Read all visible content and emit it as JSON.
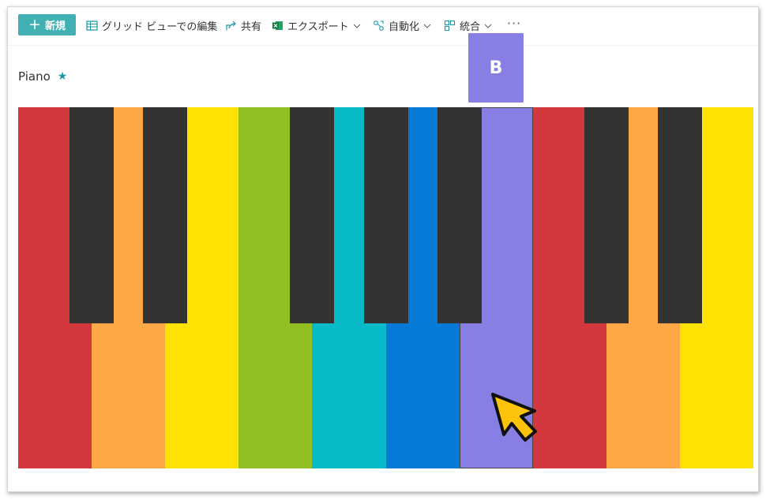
{
  "toolbar": {
    "new_label": "新規",
    "grid_edit_label": "グリッド ビューでの編集",
    "share_label": "共有",
    "export_label": "エクスポート",
    "automate_label": "自動化",
    "integrate_label": "統合",
    "more_label": "···"
  },
  "page": {
    "title": "Piano",
    "favorite_icon": "star-icon"
  },
  "piano": {
    "white_keys": [
      "#d2383e",
      "#fea746",
      "#fee204",
      "#92bf22",
      "#07bac7",
      "#0779d7",
      "#877fe3",
      "#d2383e",
      "#fea746",
      "#fee204"
    ],
    "black_keys": [
      0,
      1,
      3,
      4,
      5,
      7,
      8
    ],
    "pressed_key_index": 6,
    "pressed_key_label": "B"
  },
  "colors": {
    "accent": "#41b0b2",
    "black_key": "#353332",
    "cursor_fill": "#fcc30b"
  }
}
